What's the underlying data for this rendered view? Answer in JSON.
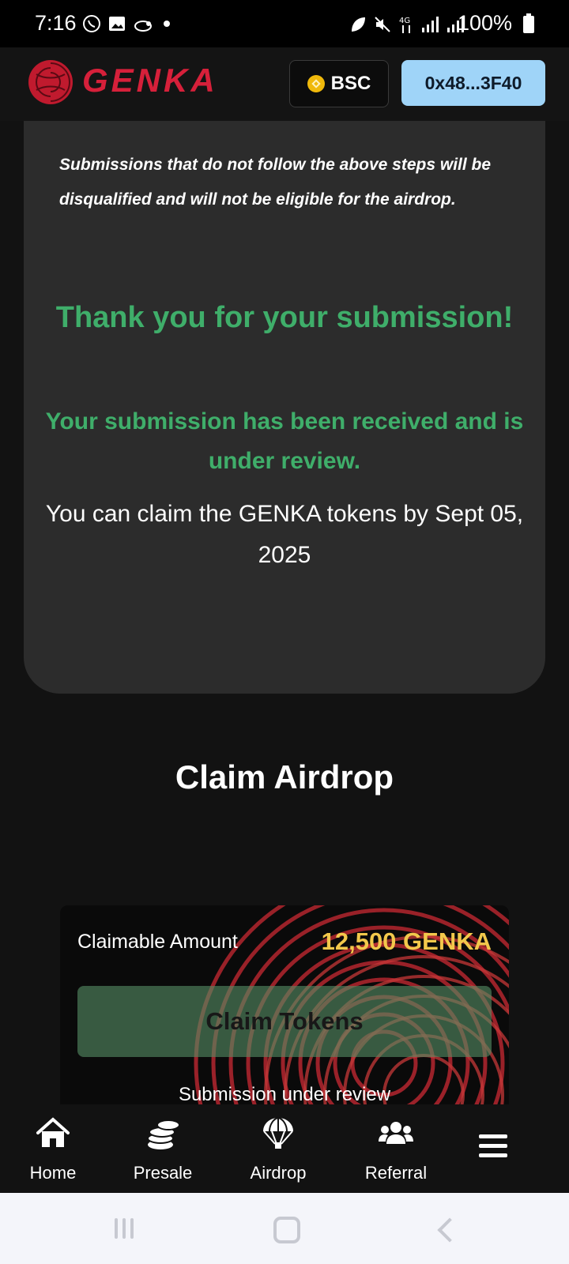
{
  "status_bar": {
    "time": "7:16",
    "battery": "100%"
  },
  "header": {
    "brand": "GENKA",
    "chain": "BSC",
    "wallet": "0x48...3F40"
  },
  "card": {
    "note": "Submissions that do not follow the above steps will be disqualified and will not be eligible for the airdrop.",
    "thanks": "Thank you for your submission!",
    "received": "Your submission has been received and is under review.",
    "claim_by": "You can claim the GENKA tokens by Sept 05, 2025"
  },
  "claim_section": {
    "title": "Claim Airdrop",
    "amount_label": "Claimable Amount",
    "amount_value": "12,500 GENKA",
    "button": "Claim Tokens",
    "status": "Submission under review"
  },
  "nav": {
    "home": "Home",
    "presale": "Presale",
    "airdrop": "Airdrop",
    "referral": "Referral"
  },
  "colors": {
    "brand_red": "#d6203a",
    "success_green": "#3fae6a",
    "amount_gold": "#f2c84b",
    "wallet_blue": "#9fd4f8"
  }
}
